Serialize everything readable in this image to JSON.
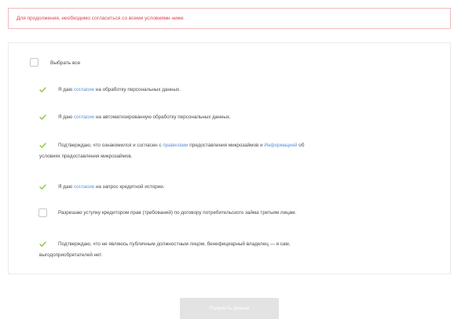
{
  "alert": {
    "text": "Для продолжения, необходимо согласиться со всеми условиями ниже"
  },
  "select_all": {
    "label": "Выбрать все",
    "checked": false
  },
  "items": [
    {
      "checked": true,
      "prefix": "Я даю ",
      "link": "согласие",
      "suffix": " на обработку персональных данных."
    },
    {
      "checked": true,
      "prefix": "Я даю ",
      "link": "согласие",
      "suffix": " на автоматизированную обработку персональных данных."
    },
    {
      "checked": true,
      "prefix": "Подтверждаю, что ознакомился и согласен с ",
      "link": "правилами",
      "middle": " предоставления микрозаймов и ",
      "link2": "Информацией",
      "suffix_line1": " об",
      "line2": "условиях предоставления микрозаймов."
    },
    {
      "checked": true,
      "prefix": "Я даю ",
      "link": "согласие",
      "suffix": " на запрос кредитной истории."
    },
    {
      "checked": false,
      "text": "Разрешаю уступку кредитором прав (требований) по договору потребительского займа третьим лицам."
    },
    {
      "checked": true,
      "line1": "Подтверждаю, что не являюсь публичным должностным лицом, бенефициарный владелец — я сам,",
      "line2": "выгодоприобретателей нет."
    }
  ],
  "submit_button": {
    "label": "Получить деньги"
  },
  "colors": {
    "alert_text": "#e0414f",
    "alert_border": "#f0b9be",
    "link": "#5b8fd6",
    "check": "#8cc63f",
    "button_bg": "#e3e3e3"
  }
}
